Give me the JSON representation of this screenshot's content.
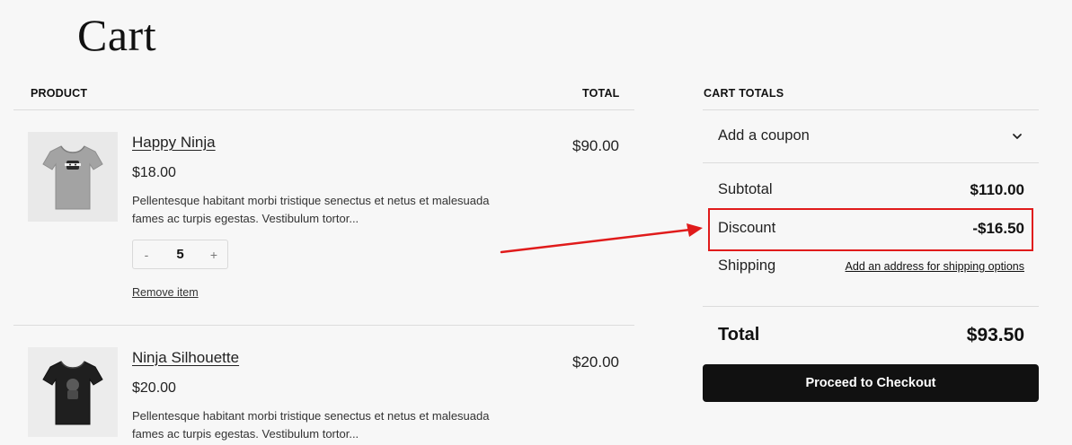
{
  "page": {
    "title": "Cart"
  },
  "table": {
    "product_header": "PRODUCT",
    "total_header": "TOTAL"
  },
  "items": [
    {
      "name": "Happy Ninja",
      "price": "$18.00",
      "description": "Pellentesque habitant morbi tristique senectus et netus et malesuada fames ac turpis egestas. Vestibulum tortor...",
      "quantity": "5",
      "line_total": "$90.00",
      "remove_label": "Remove item",
      "shirt_color": "#9e9e9e"
    },
    {
      "name": "Ninja Silhouette",
      "price": "$20.00",
      "description": "Pellentesque habitant morbi tristique senectus et netus et malesuada fames ac turpis egestas. Vestibulum tortor...",
      "line_total": "$20.00",
      "shirt_color": "#1d1d1d"
    }
  ],
  "qty_controls": {
    "minus": "-",
    "plus": "+"
  },
  "totals": {
    "header": "CART TOTALS",
    "coupon_label": "Add a coupon",
    "subtotal_label": "Subtotal",
    "subtotal_value": "$110.00",
    "discount_label": "Discount",
    "discount_value": "-$16.50",
    "shipping_label": "Shipping",
    "shipping_link": "Add an address for shipping options",
    "total_label": "Total",
    "total_value": "$93.50",
    "checkout_label": "Proceed to Checkout"
  },
  "icons": {
    "coupon_toggle": "chevron-down-icon"
  },
  "colors": {
    "highlight": "#e01b1b",
    "button_bg": "#111111",
    "background": "#f7f7f7"
  }
}
